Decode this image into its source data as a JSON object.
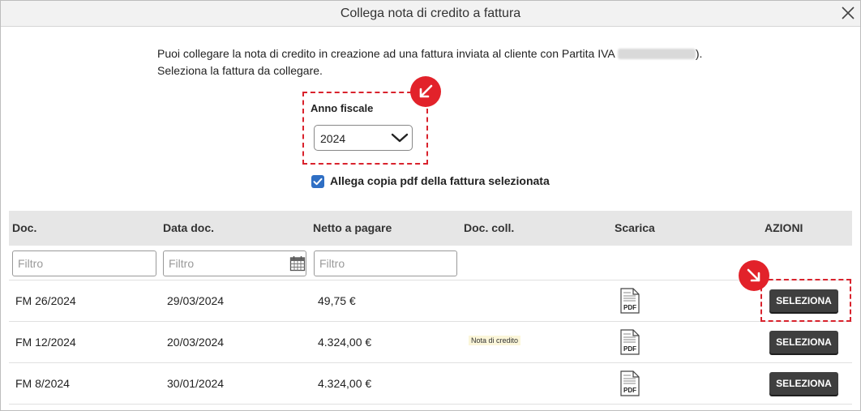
{
  "dialog": {
    "title": "Collega nota di credito a fattura",
    "intro_line1": "Puoi collegare la nota di credito in creazione ad una fattura inviata al cliente con Partita IVA ",
    "intro_line1_end": ").",
    "intro_line2": "Seleziona la fattura da collegare."
  },
  "fiscal_year": {
    "label": "Anno fiscale",
    "value": "2024"
  },
  "attach_pdf": {
    "label": "Allega copia pdf della fattura selezionata",
    "checked": true
  },
  "table": {
    "headers": {
      "doc": "Doc.",
      "date": "Data doc.",
      "net": "Netto a pagare",
      "linked": "Doc. coll.",
      "download": "Scarica",
      "actions": "AZIONI"
    },
    "filter_placeholder": "Filtro",
    "rows": [
      {
        "doc": "FM 26/2024",
        "date": "29/03/2024",
        "net": "49,75 €",
        "linked": "",
        "pdf_label": "PDF",
        "action": "SELEZIONA"
      },
      {
        "doc": "FM 12/2024",
        "date": "20/03/2024",
        "net": "4.324,00 €",
        "linked": "Nota di credito",
        "pdf_label": "PDF",
        "action": "SELEZIONA"
      },
      {
        "doc": "FM 8/2024",
        "date": "30/01/2024",
        "net": "4.324,00 €",
        "linked": "",
        "pdf_label": "PDF",
        "action": "SELEZIONA"
      }
    ]
  },
  "colors": {
    "highlight": "#d9232d",
    "checkbox": "#2f6fc4",
    "button": "#3f3f3f",
    "header_bg": "#e6e6e6"
  },
  "icons": [
    "close-icon",
    "chevron-down-icon",
    "arrow-down-left-icon",
    "arrow-down-right-icon",
    "check-icon",
    "calendar-icon",
    "pdf-file-icon"
  ]
}
